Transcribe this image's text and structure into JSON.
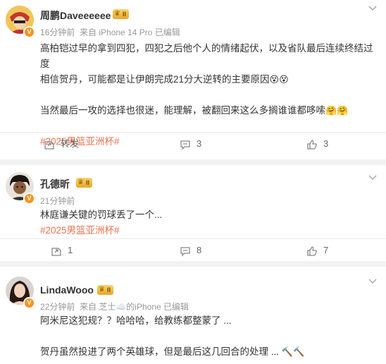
{
  "posts": [
    {
      "username": "周鹏Daveeeeee",
      "level": "II",
      "verified_mark": "V",
      "meta": "16分钟前  来自 iPhone 14 Pro 已编辑",
      "text_lines": [
        "高柏铠过早的拿到四犯，四犯之后他个人的情绪起伏，以及省队最后连续终结过度",
        "相信贺丹，可能都是让伊朗完成21分大逆转的主要原因",
        "当然最后一攻的选择也很迷，能理解，被翻回来这么多搁谁谁都哆嗦"
      ],
      "line2_emoji": "😵😵",
      "line3_emoji": "🤗🤗",
      "hashtag": "#2025男篮亚洲杯#",
      "repost_label": "转发",
      "comments": "3",
      "likes": "3"
    },
    {
      "username": "孔德昕",
      "level": "II",
      "verified_mark": "V",
      "meta": "21分钟前",
      "text_lines": [
        "林庭谦关键的罚球丢了一个..."
      ],
      "hashtag": "#2025男篮亚洲杯#",
      "reposts": "1",
      "comments": "8",
      "likes": "7"
    },
    {
      "username": "LindaWooo",
      "level": "II",
      "verified_mark": "V",
      "meta": "22分钟前  来自 芝士☁️的iPhone 已编辑",
      "text_lines": [
        "阿米尼这犯规？？哈哈哈，给教练都整蒙了 ...",
        "贺丹虽然投进了两个英雄球，但是最后这几回合的处理 ..."
      ],
      "line2_emoji": "🔨🔨"
    }
  ],
  "icons": {
    "more": "more-icon",
    "repost": "repost-icon",
    "comment": "comment-icon",
    "like": "like-icon"
  },
  "colors": {
    "hashtag": "#eb7350",
    "meta": "#999999",
    "verified": "#f7931e",
    "level_badge": "#e6a72a"
  }
}
